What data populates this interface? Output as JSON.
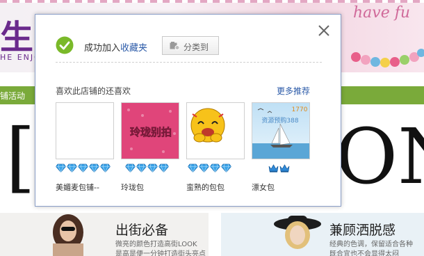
{
  "background": {
    "logo_big": "生",
    "logo_sub": "HE ENJO",
    "banner_script": "have fu",
    "nav_item": "铺活动",
    "big_left": "[",
    "big_right": "ON",
    "promo_left": {
      "title": "出街必备",
      "line1": "微亮的颜色打造高街LOOK",
      "line2": "是高是便一分钟打造街头亮点"
    },
    "promo_right": {
      "title": "兼顾洒脱感",
      "line1": "经典的色调，保留适合各种",
      "line2": "既合宜也不会显得太闷"
    }
  },
  "dialog": {
    "success_prefix": "成功加入",
    "success_link": "收藏夹",
    "categorize_label": "分类到",
    "recommend_title": "喜欢此店铺的还喜欢",
    "more_label": "更多推荐",
    "thumb_texts": {
      "item2": "玲珑别拍",
      "item4_top": "1770",
      "item4_mid": "资源预购388"
    },
    "items": [
      {
        "name": "美媚麦包铺--",
        "rating_icon": "blue-diamond",
        "rating_count": 5
      },
      {
        "name": "玲珑包",
        "rating_icon": "blue-diamond",
        "rating_count": 4
      },
      {
        "name": "蛮熟的包包",
        "rating_icon": "blue-diamond",
        "rating_count": 4
      },
      {
        "name": "漂女包",
        "rating_icon": "blue-crown",
        "rating_count": 2
      }
    ],
    "colors": {
      "link": "#2b5aa8",
      "check": "#7ab929",
      "border": "#8a9ec8",
      "nav": "#7aaa3a"
    }
  }
}
